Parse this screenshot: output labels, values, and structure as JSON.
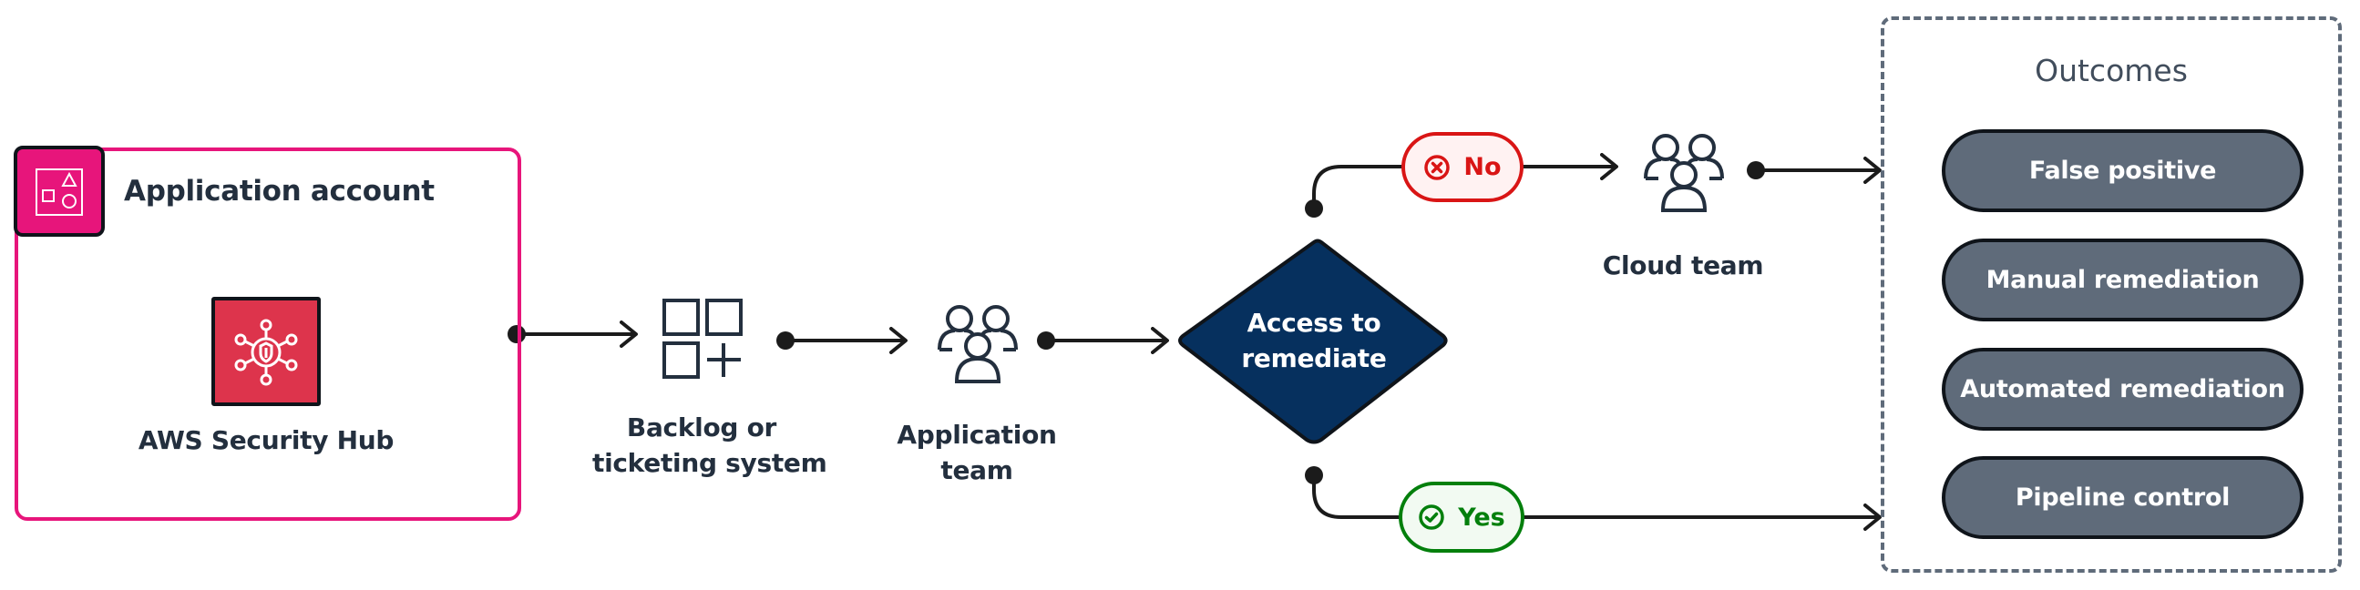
{
  "diagram": {
    "application_account": {
      "title": "Application account",
      "icon": "account-group-icon",
      "service": {
        "label": "AWS Security Hub",
        "icon": "security-hub-icon"
      }
    },
    "nodes": {
      "backlog": {
        "line1": "Backlog or",
        "line2": "ticketing system",
        "icon": "backlog-grid-icon"
      },
      "application_team": {
        "line1": "Application",
        "line2": "team",
        "icon": "users-group-icon"
      },
      "decision": {
        "line1": "Access to",
        "line2": "remediate"
      },
      "cloud_team": {
        "label": "Cloud team",
        "icon": "users-group-icon"
      }
    },
    "branches": {
      "no": {
        "label": "No",
        "icon": "x-circle-icon"
      },
      "yes": {
        "label": "Yes",
        "icon": "check-circle-icon"
      }
    },
    "outcomes": {
      "title": "Outcomes",
      "items": [
        {
          "label": "False positive"
        },
        {
          "label": "Manual remediation"
        },
        {
          "label": "Automated remediation"
        },
        {
          "label": "Pipeline control"
        }
      ]
    },
    "colors": {
      "account_pink": "#e7157b",
      "security_hub_red": "#dd344c",
      "decision_navy": "#06305e",
      "no_red": "#d91515",
      "yes_green": "#037f0c",
      "outcome_gray": "#5f6b7a",
      "text_dark": "#232f3e"
    }
  }
}
